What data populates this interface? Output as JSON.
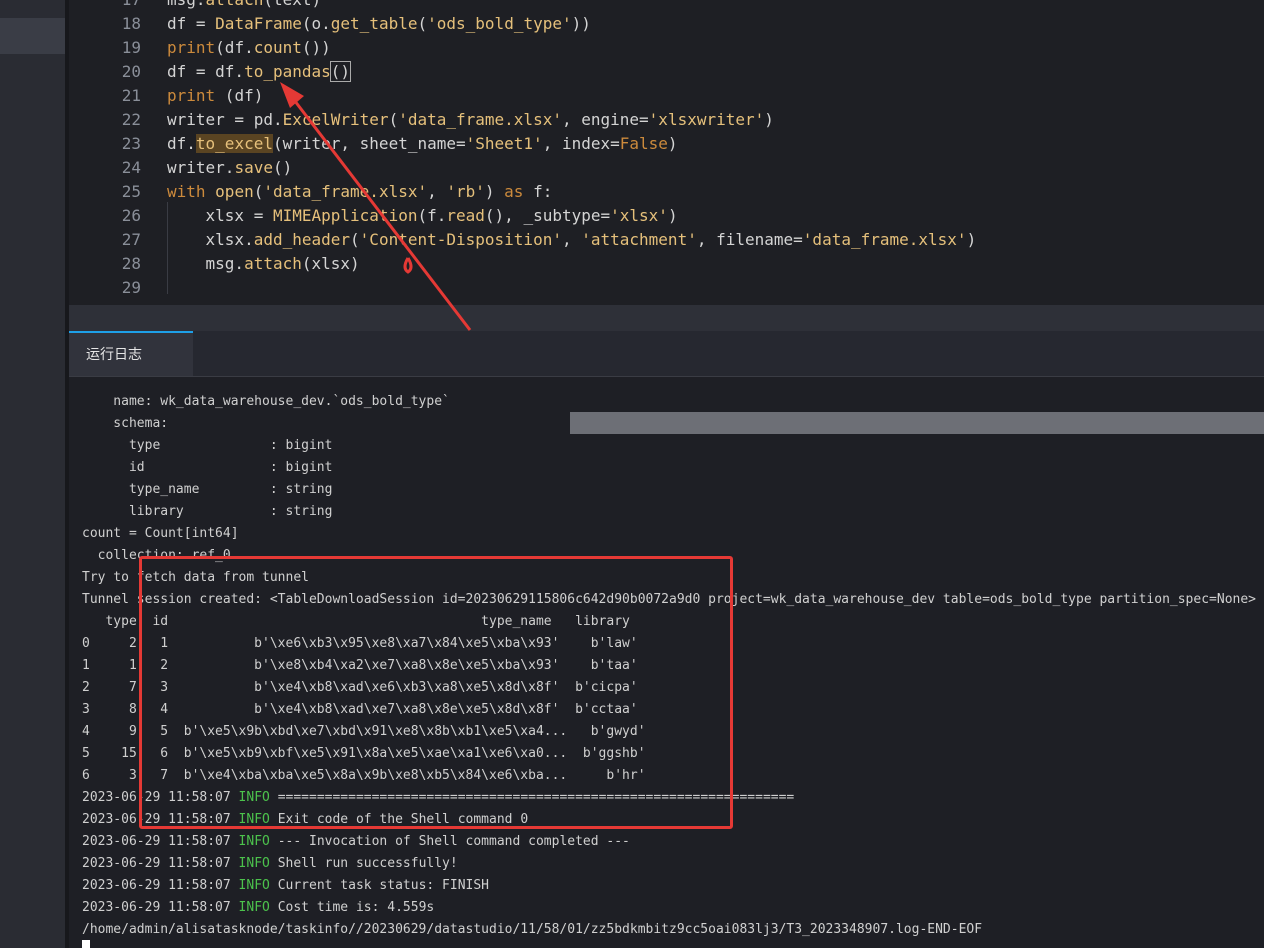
{
  "code_lines": [
    {
      "num": "17",
      "parts": [
        {
          "t": "msg.",
          "c": ""
        },
        {
          "t": "attach",
          "c": "fn"
        },
        {
          "t": "(text)",
          "c": ""
        }
      ]
    },
    {
      "num": "18",
      "parts": [
        {
          "t": "df = ",
          "c": ""
        },
        {
          "t": "DataFrame",
          "c": "fn"
        },
        {
          "t": "(o.",
          "c": ""
        },
        {
          "t": "get_table",
          "c": "fn"
        },
        {
          "t": "(",
          "c": ""
        },
        {
          "t": "'ods_bold_type'",
          "c": "str"
        },
        {
          "t": "))",
          "c": ""
        }
      ]
    },
    {
      "num": "19",
      "parts": [
        {
          "t": "print",
          "c": "kw"
        },
        {
          "t": "(df.",
          "c": ""
        },
        {
          "t": "count",
          "c": "fn"
        },
        {
          "t": "())",
          "c": ""
        }
      ]
    },
    {
      "num": "20",
      "parts": [
        {
          "t": "df = df.",
          "c": ""
        },
        {
          "t": "to_pandas",
          "c": "fn"
        },
        {
          "t": "()",
          "c": "cur"
        }
      ]
    },
    {
      "num": "21",
      "parts": [
        {
          "t": "print",
          "c": "kw"
        },
        {
          "t": " (df)",
          "c": ""
        }
      ]
    },
    {
      "num": "22",
      "parts": [
        {
          "t": "writer = pd.",
          "c": ""
        },
        {
          "t": "ExcelWriter",
          "c": "fn"
        },
        {
          "t": "(",
          "c": ""
        },
        {
          "t": "'data_frame.xlsx'",
          "c": "str"
        },
        {
          "t": ", engine=",
          "c": ""
        },
        {
          "t": "'xlsxwriter'",
          "c": "str"
        },
        {
          "t": ")",
          "c": ""
        }
      ]
    },
    {
      "num": "23",
      "parts": [
        {
          "t": "df.",
          "c": ""
        },
        {
          "t": "to_excel",
          "c": "fn hl"
        },
        {
          "t": "(writer, sheet_name=",
          "c": ""
        },
        {
          "t": "'Sheet1'",
          "c": "str"
        },
        {
          "t": ", index=",
          "c": ""
        },
        {
          "t": "False",
          "c": "kw"
        },
        {
          "t": ")",
          "c": ""
        }
      ]
    },
    {
      "num": "24",
      "parts": [
        {
          "t": "writer.",
          "c": ""
        },
        {
          "t": "save",
          "c": "fn"
        },
        {
          "t": "()",
          "c": ""
        }
      ]
    },
    {
      "num": "25",
      "parts": [
        {
          "t": "with",
          "c": "kw"
        },
        {
          "t": " ",
          "c": ""
        },
        {
          "t": "open",
          "c": "fn"
        },
        {
          "t": "(",
          "c": ""
        },
        {
          "t": "'data_frame.xlsx'",
          "c": "str"
        },
        {
          "t": ", ",
          "c": ""
        },
        {
          "t": "'rb'",
          "c": "str"
        },
        {
          "t": ") ",
          "c": ""
        },
        {
          "t": "as",
          "c": "kw"
        },
        {
          "t": " f:",
          "c": ""
        }
      ]
    },
    {
      "num": "26",
      "parts": [
        {
          "t": "    xlsx = ",
          "c": ""
        },
        {
          "t": "MIMEApplication",
          "c": "fn"
        },
        {
          "t": "(f.",
          "c": ""
        },
        {
          "t": "read",
          "c": "fn"
        },
        {
          "t": "(), _subtype=",
          "c": ""
        },
        {
          "t": "'xlsx'",
          "c": "str"
        },
        {
          "t": ")",
          "c": ""
        }
      ]
    },
    {
      "num": "27",
      "parts": [
        {
          "t": "    xlsx.",
          "c": ""
        },
        {
          "t": "add_header",
          "c": "fn"
        },
        {
          "t": "(",
          "c": ""
        },
        {
          "t": "'Content-Disposition'",
          "c": "str"
        },
        {
          "t": ", ",
          "c": ""
        },
        {
          "t": "'attachment'",
          "c": "str"
        },
        {
          "t": ", filename=",
          "c": ""
        },
        {
          "t": "'data_frame.xlsx'",
          "c": "str"
        },
        {
          "t": ")",
          "c": ""
        }
      ]
    },
    {
      "num": "28",
      "parts": [
        {
          "t": "    msg.",
          "c": ""
        },
        {
          "t": "attach",
          "c": "fn"
        },
        {
          "t": "(xlsx)",
          "c": ""
        }
      ]
    },
    {
      "num": "29",
      "parts": [
        {
          "t": "",
          "c": ""
        }
      ]
    }
  ],
  "log_tab_label": "运行日志",
  "log_lines": [
    {
      "text": "    name: wk_data_warehouse_dev.`ods_bold_type`"
    },
    {
      "text": "    schema:"
    },
    {
      "text": "      type              : bigint"
    },
    {
      "text": "      id                : bigint"
    },
    {
      "text": "      type_name         : string"
    },
    {
      "text": "      library           : string"
    },
    {
      "text": "count = Count[int64]"
    },
    {
      "text": "  collection: ref_0"
    },
    {
      "text": "Try to fetch data from tunnel"
    },
    {
      "text": "Tunnel session created: <TableDownloadSession id=20230629115806c642d90b0072a9d0 project=wk_data_warehouse_dev table=ods_bold_type partition_spec=None>"
    },
    {
      "text": "   type  id                                        type_name   library"
    },
    {
      "text": "0     2   1           b'\\xe6\\xb3\\x95\\xe8\\xa7\\x84\\xe5\\xba\\x93'    b'law'"
    },
    {
      "text": "1     1   2           b'\\xe8\\xb4\\xa2\\xe7\\xa8\\x8e\\xe5\\xba\\x93'    b'taa'"
    },
    {
      "text": "2     7   3           b'\\xe4\\xb8\\xad\\xe6\\xb3\\xa8\\xe5\\x8d\\x8f'  b'cicpa'"
    },
    {
      "text": "3     8   4           b'\\xe4\\xb8\\xad\\xe7\\xa8\\x8e\\xe5\\x8d\\x8f'  b'cctaa'"
    },
    {
      "text": "4     9   5  b'\\xe5\\x9b\\xbd\\xe7\\xbd\\x91\\xe8\\x8b\\xb1\\xe5\\xa4...   b'gwyd'"
    },
    {
      "text": "5    15   6  b'\\xe5\\xb9\\xbf\\xe5\\x91\\x8a\\xe5\\xae\\xa1\\xe6\\xa0...  b'ggshb'"
    },
    {
      "text": "6     3   7  b'\\xe4\\xba\\xba\\xe5\\x8a\\x9b\\xe8\\xb5\\x84\\xe6\\xba...     b'hr'"
    },
    {
      "ts": "2023-06-29 11:58:07",
      "level": "INFO",
      "msg": "=================================================================="
    },
    {
      "ts": "2023-06-29 11:58:07",
      "level": "INFO",
      "msg": "Exit code of the Shell command 0"
    },
    {
      "ts": "2023-06-29 11:58:07",
      "level": "INFO",
      "msg": "--- Invocation of Shell command completed ---"
    },
    {
      "ts": "2023-06-29 11:58:07",
      "level": "INFO",
      "msg": "Shell run successfully!"
    },
    {
      "ts": "2023-06-29 11:58:07",
      "level": "INFO",
      "msg": "Current task status: FINISH"
    },
    {
      "ts": "2023-06-29 11:58:07",
      "level": "INFO",
      "msg": "Cost time is: 4.559s"
    },
    {
      "text": "/home/admin/alisatasknode/taskinfo//20230629/datastudio/11/58/01/zz5bdkmbitz9cc5oai083lj3/T3_2023348907.log-END-EOF"
    }
  ],
  "colors": {
    "accent": "#1ea0e8",
    "annotation_red": "#e53935",
    "info_green": "#4cc24c",
    "keyword": "#cc8a3c",
    "function": "#e6c07b"
  }
}
